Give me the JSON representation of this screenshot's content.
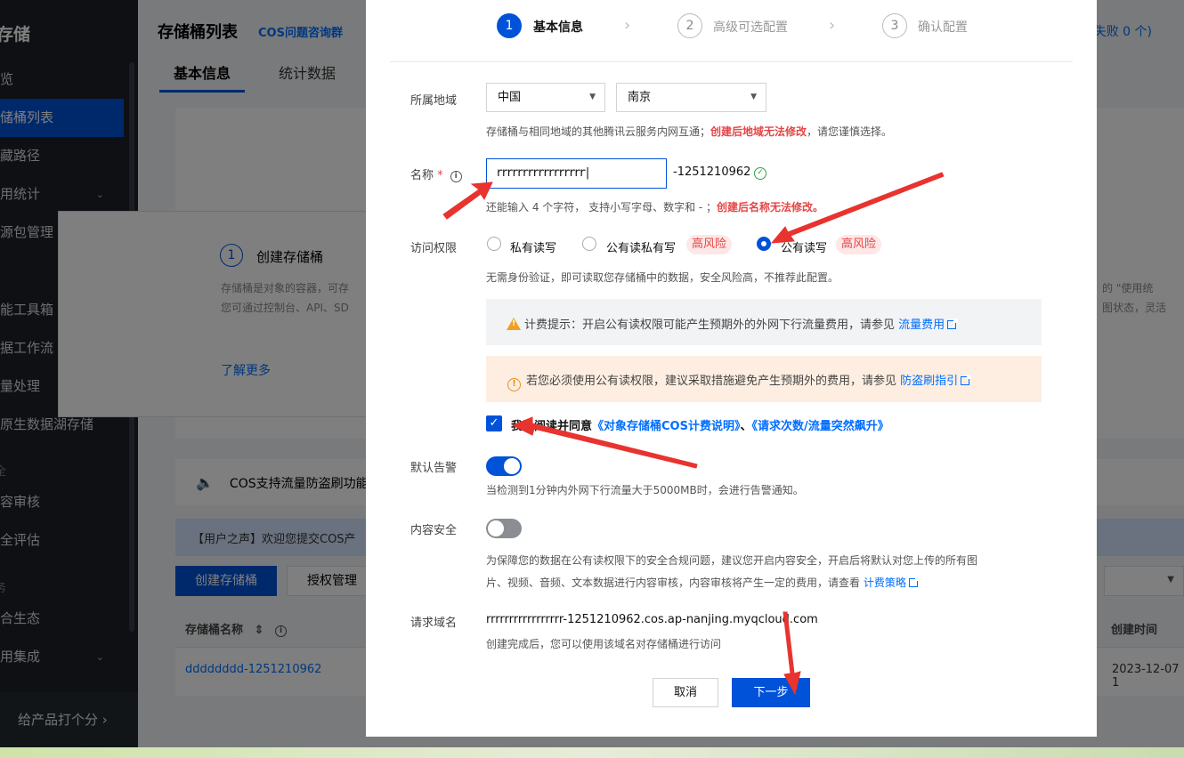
{
  "sidebar": {
    "brand": "存储",
    "items": [
      {
        "label": "览",
        "top": 0
      },
      {
        "label": "储桶列表"
      },
      {
        "label": "藏路径"
      },
      {
        "label": "用统计"
      },
      {
        "label": "源包管理"
      },
      {
        "label": "能工具箱"
      },
      {
        "label": "据工作流"
      },
      {
        "label": "量处理"
      },
      {
        "label": "原生数据湖存储"
      },
      {
        "label": "容审核"
      },
      {
        "label": "全评估"
      },
      {
        "label": "合生态"
      },
      {
        "label": "用集成"
      }
    ],
    "groups": [
      "全",
      "务"
    ],
    "rate": "给产品打个分"
  },
  "main": {
    "title": "存储桶列表",
    "qr_link": "COS问题咨询群",
    "tabs": [
      "基本信息",
      "统计数据"
    ],
    "top_right": "失败 0 个)",
    "step_num": "1",
    "step_title": "创建存储桶",
    "step_desc_1": "存储桶是对象的容器，可存",
    "step_desc_2": "您可通过控制台、API、SD",
    "right_desc_1": "的 \"使用统",
    "right_desc_2": "图状态，灵活",
    "learn_more": "了解更多",
    "notice": "COS支持流量防盗刷功能",
    "voice": "【用户之声】欢迎您提交COS产",
    "create_btn": "创建存储桶",
    "auth_btn": "授权管理",
    "th_name": "存储桶名称",
    "th_created": "创建时间",
    "row_name": "dddddddd-1251210962",
    "row_created": "2023-12-07 1"
  },
  "modal": {
    "steps": [
      {
        "num": "1",
        "label": "基本信息"
      },
      {
        "num": "2",
        "label": "高级可选配置"
      },
      {
        "num": "3",
        "label": "确认配置"
      }
    ],
    "region": {
      "label": "所属地域",
      "country": "中国",
      "city": "南京",
      "hint_pre": "存储桶与相同地域的其他腾讯云服务内网互通；",
      "hint_warn": "创建后地域无法修改",
      "hint_post": "，请您谨慎选择。"
    },
    "name": {
      "label": "名称",
      "required_mark": "*",
      "value": "rrrrrrrrrrrrrrrrr",
      "suffix": "-1251210962",
      "hint_pre": "还能输入 4 个字符， 支持小写字母、数字和 - ；",
      "hint_warn": "创建后名称无法修改。"
    },
    "access": {
      "label": "访问权限",
      "options": [
        "私有读写",
        "公有读私有写",
        "公有读写"
      ],
      "risk_tag": "高风险",
      "selected": "公有读写",
      "hint": "无需身份验证，即可读取您存储桶中的数据，安全风险高，不推荐此配置。",
      "fee_tip": "计费提示：开启公有读权限可能产生预期外的外网下行流量费用，请参见",
      "fee_link": "流量费用",
      "warn_tip": "若您必须使用公有读权限，建议采取措施避免产生预期外的费用，请参见",
      "warn_link": "防盗刷指引",
      "agree_pre": "我已阅读并同意",
      "agree_link1": "《对象存储桶COS计费说明》",
      "agree_sep": "、",
      "agree_link2": "《请求次数/流量突然飙升》"
    },
    "alarm": {
      "label": "默认告警",
      "enabled": true,
      "hint": "当检测到1分钟内外网下行流量大于5000MB时，会进行告警通知。"
    },
    "content_security": {
      "label": "内容安全",
      "enabled": false,
      "hint_1": "为保障您的数据在公有读权限下的安全合规问题，建议您开启内容安全，开启后将默认对您上传的所有图",
      "hint_2": "片、视频、音频、文本数据进行内容审核，内容审核将产生一定的费用，请查看",
      "hint_link": "计费策略"
    },
    "domain": {
      "label": "请求域名",
      "value": "rrrrrrrrrrrrrrrrr-1251210962.cos.ap-nanjing.myqcloud.com",
      "hint": "创建完成后，您可以使用该域名对存储桶进行访问"
    },
    "cancel_label": "取消",
    "next_label": "下一步"
  },
  "colors": {
    "primary": "#0052d9",
    "danger": "#e54545",
    "annotation": "#e8332f"
  }
}
